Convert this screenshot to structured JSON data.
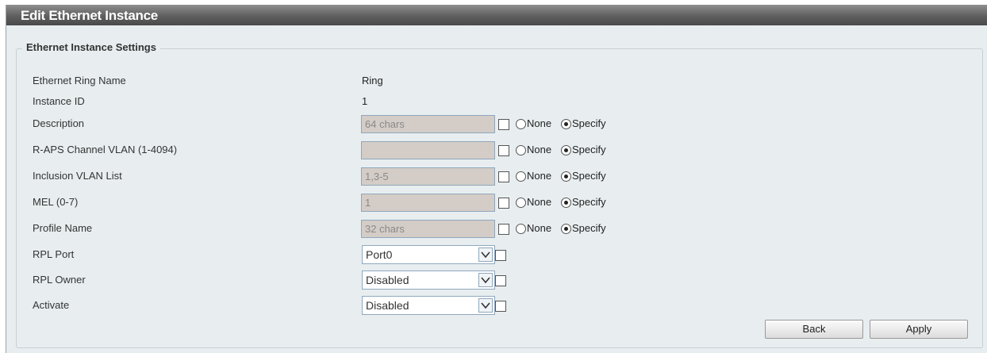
{
  "window": {
    "title": "Edit Ethernet Instance"
  },
  "section": {
    "legend": "Ethernet Instance Settings"
  },
  "fields": {
    "ring_name": {
      "label": "Ethernet Ring Name",
      "value": "Ring"
    },
    "instance_id": {
      "label": "Instance ID",
      "value": "1"
    },
    "description": {
      "label": "Description",
      "value": "64 chars"
    },
    "raps_vlan": {
      "label": "R-APS Channel VLAN (1-4094)",
      "value": ""
    },
    "inclusion_vlan": {
      "label": "Inclusion VLAN List",
      "value": "1,3-5"
    },
    "mel": {
      "label": "MEL (0-7)",
      "value": "1"
    },
    "profile_name": {
      "label": "Profile Name",
      "value": "32 chars"
    },
    "rpl_port": {
      "label": "RPL Port",
      "selected": "Port0"
    },
    "rpl_owner": {
      "label": "RPL Owner",
      "selected": "Disabled"
    },
    "activate": {
      "label": "Activate",
      "selected": "Disabled"
    }
  },
  "options": {
    "none": "None",
    "specify": "Specify"
  },
  "buttons": {
    "back": "Back",
    "apply": "Apply"
  }
}
